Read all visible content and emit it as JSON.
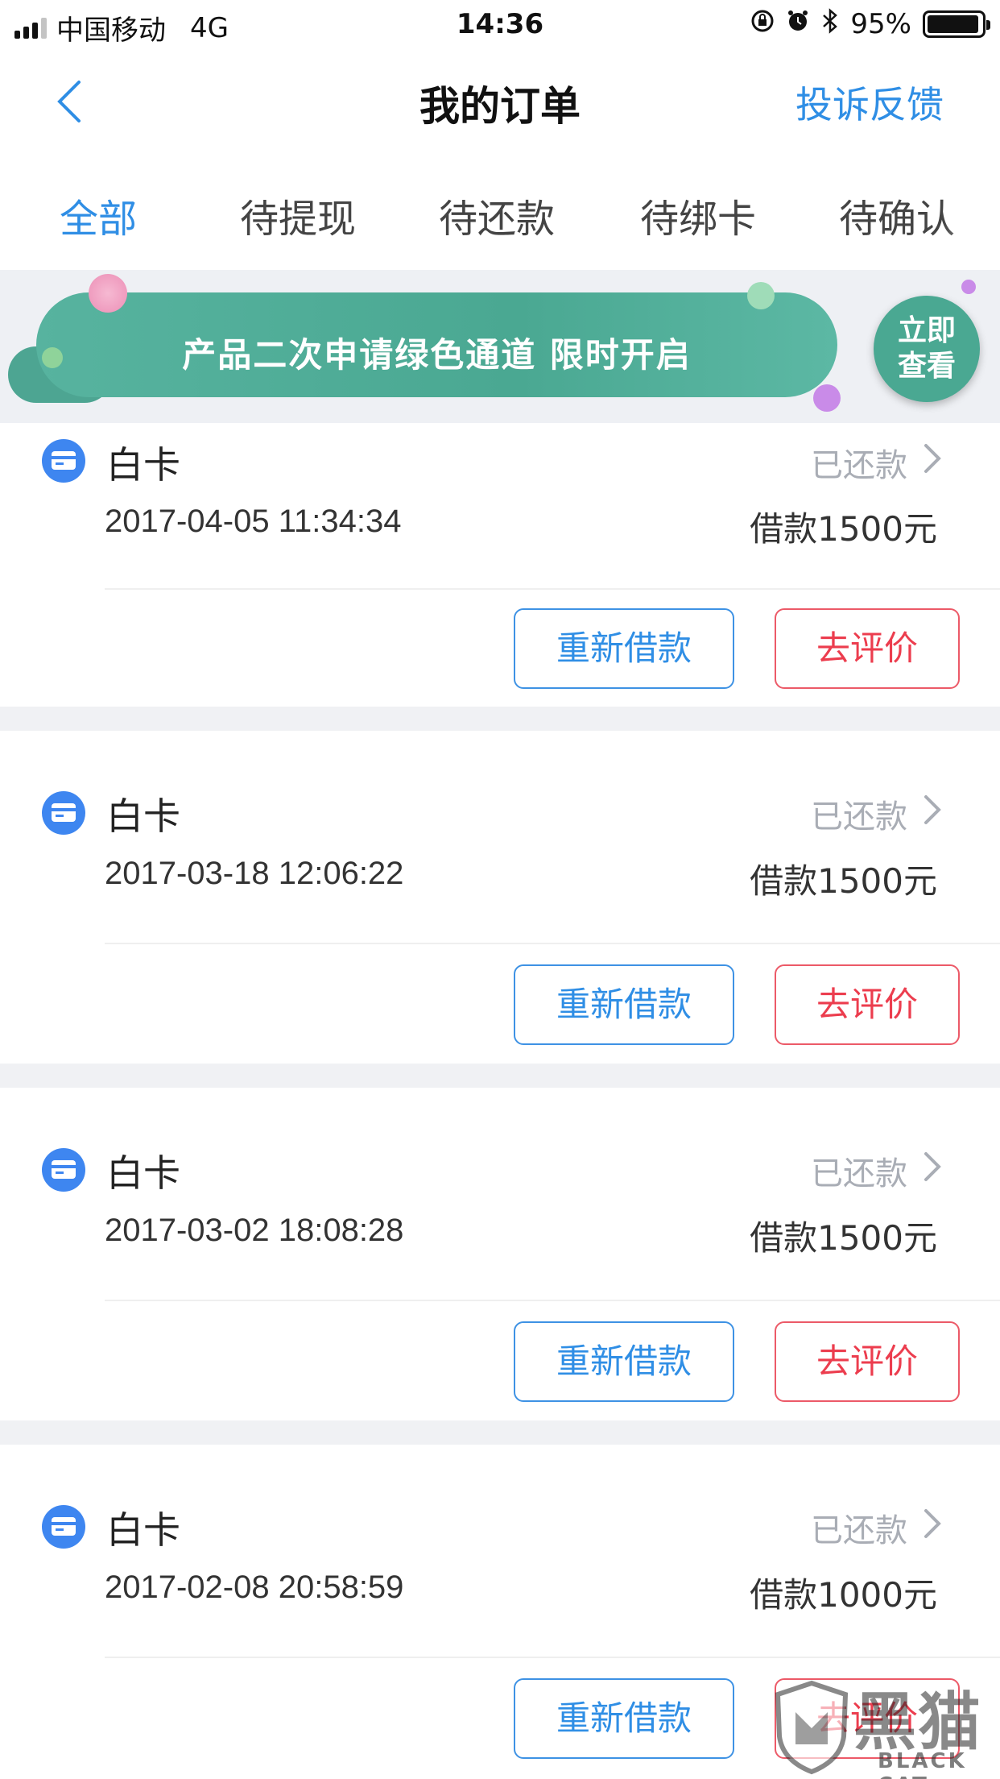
{
  "status_bar": {
    "carrier": "中国移动",
    "network": "4G",
    "time": "14:36",
    "battery": "95%",
    "battery_level": 0.95
  },
  "nav": {
    "title": "我的订单",
    "right_action": "投诉反馈",
    "accent_color": "#2f8ee5"
  },
  "tabs": [
    {
      "label": "全部",
      "active": true
    },
    {
      "label": "待提现",
      "active": false
    },
    {
      "label": "待还款",
      "active": false
    },
    {
      "label": "待绑卡",
      "active": false
    },
    {
      "label": "待确认",
      "active": false
    }
  ],
  "banner": {
    "text": "产品二次申请绿色通道 限时开启",
    "button_line1": "立即",
    "button_line2": "查看",
    "color": "#4aa892"
  },
  "orders": [
    {
      "product": "白卡",
      "status": "已还款",
      "time": "2017-04-05 11:34:34",
      "amount": "借款1500元",
      "action_primary": "重新借款",
      "action_secondary": "去评价"
    },
    {
      "product": "白卡",
      "status": "已还款",
      "time": "2017-03-18 12:06:22",
      "amount": "借款1500元",
      "action_primary": "重新借款",
      "action_secondary": "去评价"
    },
    {
      "product": "白卡",
      "status": "已还款",
      "time": "2017-03-02 18:08:28",
      "amount": "借款1500元",
      "action_primary": "重新借款",
      "action_secondary": "去评价"
    },
    {
      "product": "白卡",
      "status": "已还款",
      "time": "2017-02-08 20:58:59",
      "amount": "借款1000元",
      "action_primary": "重新借款",
      "action_secondary": "去评价"
    }
  ],
  "icons": {
    "product": "card-icon",
    "back": "chevron-left-icon",
    "detail": "chevron-right-icon"
  },
  "watermark": {
    "text": "黑猫",
    "sub": "BLACK CAT"
  }
}
